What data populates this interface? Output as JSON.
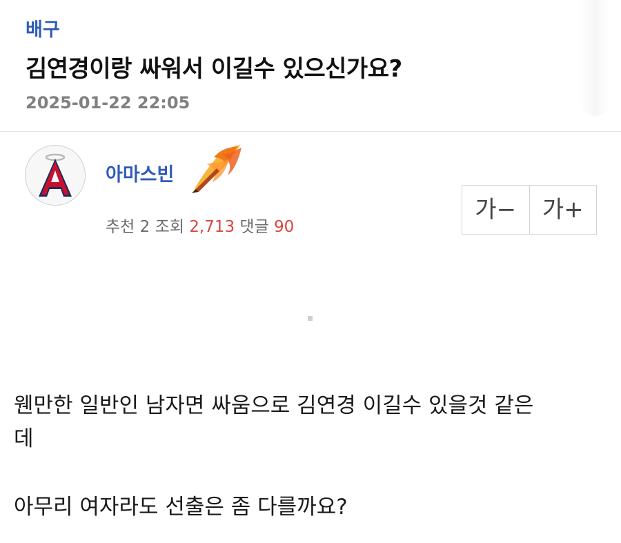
{
  "post": {
    "category": "배구",
    "title": "김연경이랑 싸워서 이길수 있으신가요?",
    "date": "2025-01-22 22:05"
  },
  "author": {
    "nickname": "아마스빈",
    "avatar_icon": "angels-logo-icon",
    "rank_icon": "flaming-pen-icon"
  },
  "stats": {
    "recommend_label": "추천",
    "recommend_count": "2",
    "views_label": "조회",
    "views_count": "2,713",
    "comments_label": "댓글",
    "comments_count": "90"
  },
  "font_size": {
    "decrease_label": "가−",
    "increase_label": "가+"
  },
  "content": {
    "line1": "웬만한 일반인 남자면 싸움으로 김연경 이길수 있을것 같은",
    "line1_cont": "데",
    "line2": "아무리 여자라도 선출은 좀 다를까요?"
  },
  "colors": {
    "accent": "#2f5bb7",
    "stat_highlight": "#d8473f",
    "muted": "#808080"
  }
}
